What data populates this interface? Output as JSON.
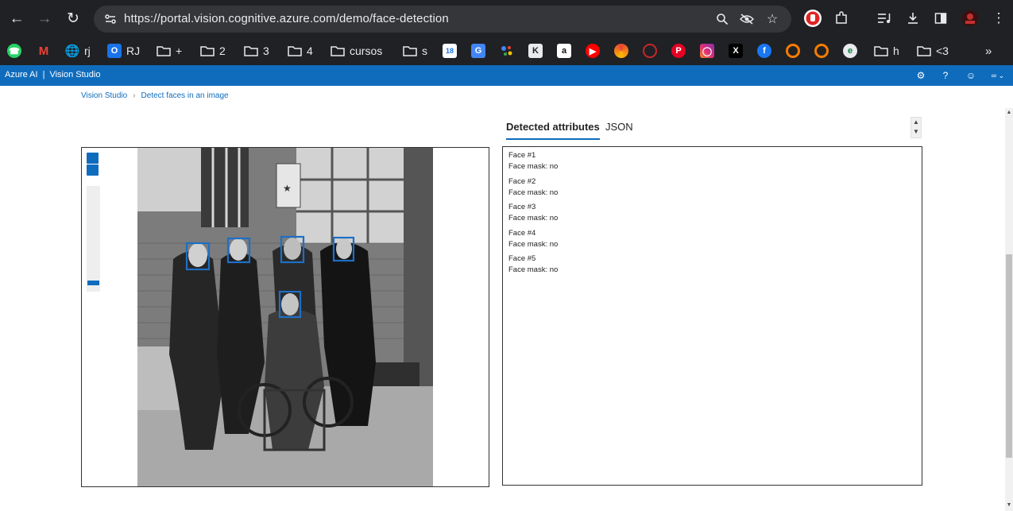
{
  "browser": {
    "url": "https://portal.vision.cognitive.azure.com/demo/face-detection",
    "bookmarks": [
      {
        "label": "rj"
      },
      {
        "label": "RJ"
      },
      {
        "label": "+"
      },
      {
        "label": "2"
      },
      {
        "label": "3"
      },
      {
        "label": "4"
      },
      {
        "label": "cursos"
      },
      {
        "label": "s"
      },
      {
        "label": "18"
      },
      {
        "label": "h"
      },
      {
        "label": "<3"
      }
    ]
  },
  "app": {
    "brand": "Azure AI",
    "separator": "|",
    "product": "Vision Studio"
  },
  "breadcrumb": {
    "home": "Vision Studio",
    "current": "Detect faces in an image"
  },
  "tabs": [
    {
      "label": "Detected attributes",
      "active": true
    },
    {
      "label": "JSON",
      "active": false
    }
  ],
  "faces": [
    {
      "title": "Face #1",
      "mask": "Face mask: no"
    },
    {
      "title": "Face #2",
      "mask": "Face mask: no"
    },
    {
      "title": "Face #3",
      "mask": "Face mask: no"
    },
    {
      "title": "Face #4",
      "mask": "Face mask: no"
    },
    {
      "title": "Face #5",
      "mask": "Face mask: no"
    }
  ],
  "colors": {
    "azure_blue": "#0f6cbd",
    "face_box": "#1e6fc5",
    "chrome_dark": "#202124"
  }
}
